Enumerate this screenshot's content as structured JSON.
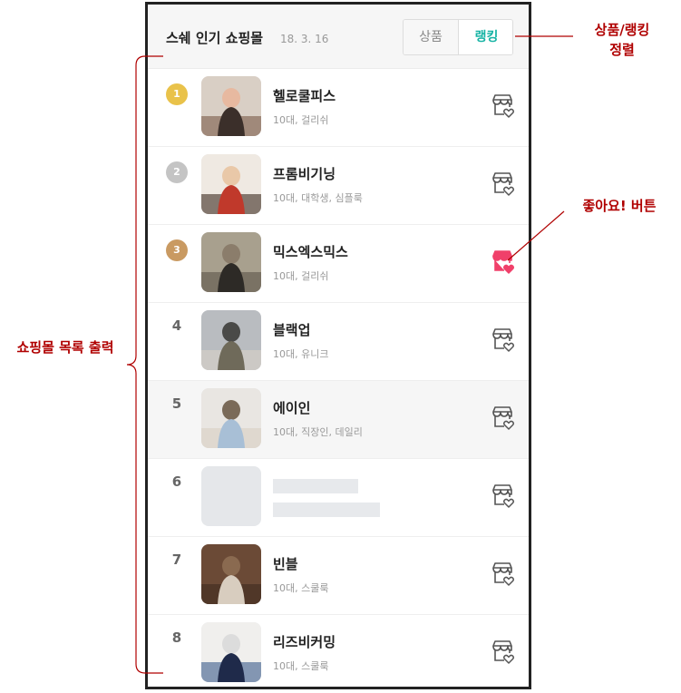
{
  "header": {
    "title": "스쉐 인기 쇼핑몰",
    "date": "18. 3. 16",
    "sort_products": "상품",
    "sort_ranking": "랭킹"
  },
  "shops": [
    {
      "rank": "1",
      "name": "헬로쿨피스",
      "tags": "10대, 걸리쉬",
      "liked": false,
      "highlight": false,
      "placeholder": false
    },
    {
      "rank": "2",
      "name": "프롬비기닝",
      "tags": "10대, 대학생, 심플룩",
      "liked": false,
      "highlight": false,
      "placeholder": false
    },
    {
      "rank": "3",
      "name": "믹스엑스믹스",
      "tags": "10대, 걸리쉬",
      "liked": true,
      "highlight": false,
      "placeholder": false
    },
    {
      "rank": "4",
      "name": "블랙업",
      "tags": "10대, 유니크",
      "liked": false,
      "highlight": false,
      "placeholder": false
    },
    {
      "rank": "5",
      "name": "에이인",
      "tags": "10대, 직장인, 데일리",
      "liked": false,
      "highlight": true,
      "placeholder": false
    },
    {
      "rank": "6",
      "name": "",
      "tags": "",
      "liked": false,
      "highlight": false,
      "placeholder": true
    },
    {
      "rank": "7",
      "name": "빈블",
      "tags": "10대, 스쿨룩",
      "liked": false,
      "highlight": false,
      "placeholder": false
    },
    {
      "rank": "8",
      "name": "리즈비커밍",
      "tags": "10대, 스쿨룩",
      "liked": false,
      "highlight": false,
      "placeholder": false
    }
  ],
  "annotations": {
    "sort": [
      "상품/랭킹",
      "정렬"
    ],
    "like": "좋아요! 버튼",
    "list": "쇼핑몰 목록 출력"
  },
  "colors": {
    "accent": "#16b3a4",
    "annotation": "#b00000",
    "like_active": "#f0406a",
    "gold": "#e9c24a",
    "silver": "#c4c4c4",
    "bronze": "#c99a62"
  }
}
